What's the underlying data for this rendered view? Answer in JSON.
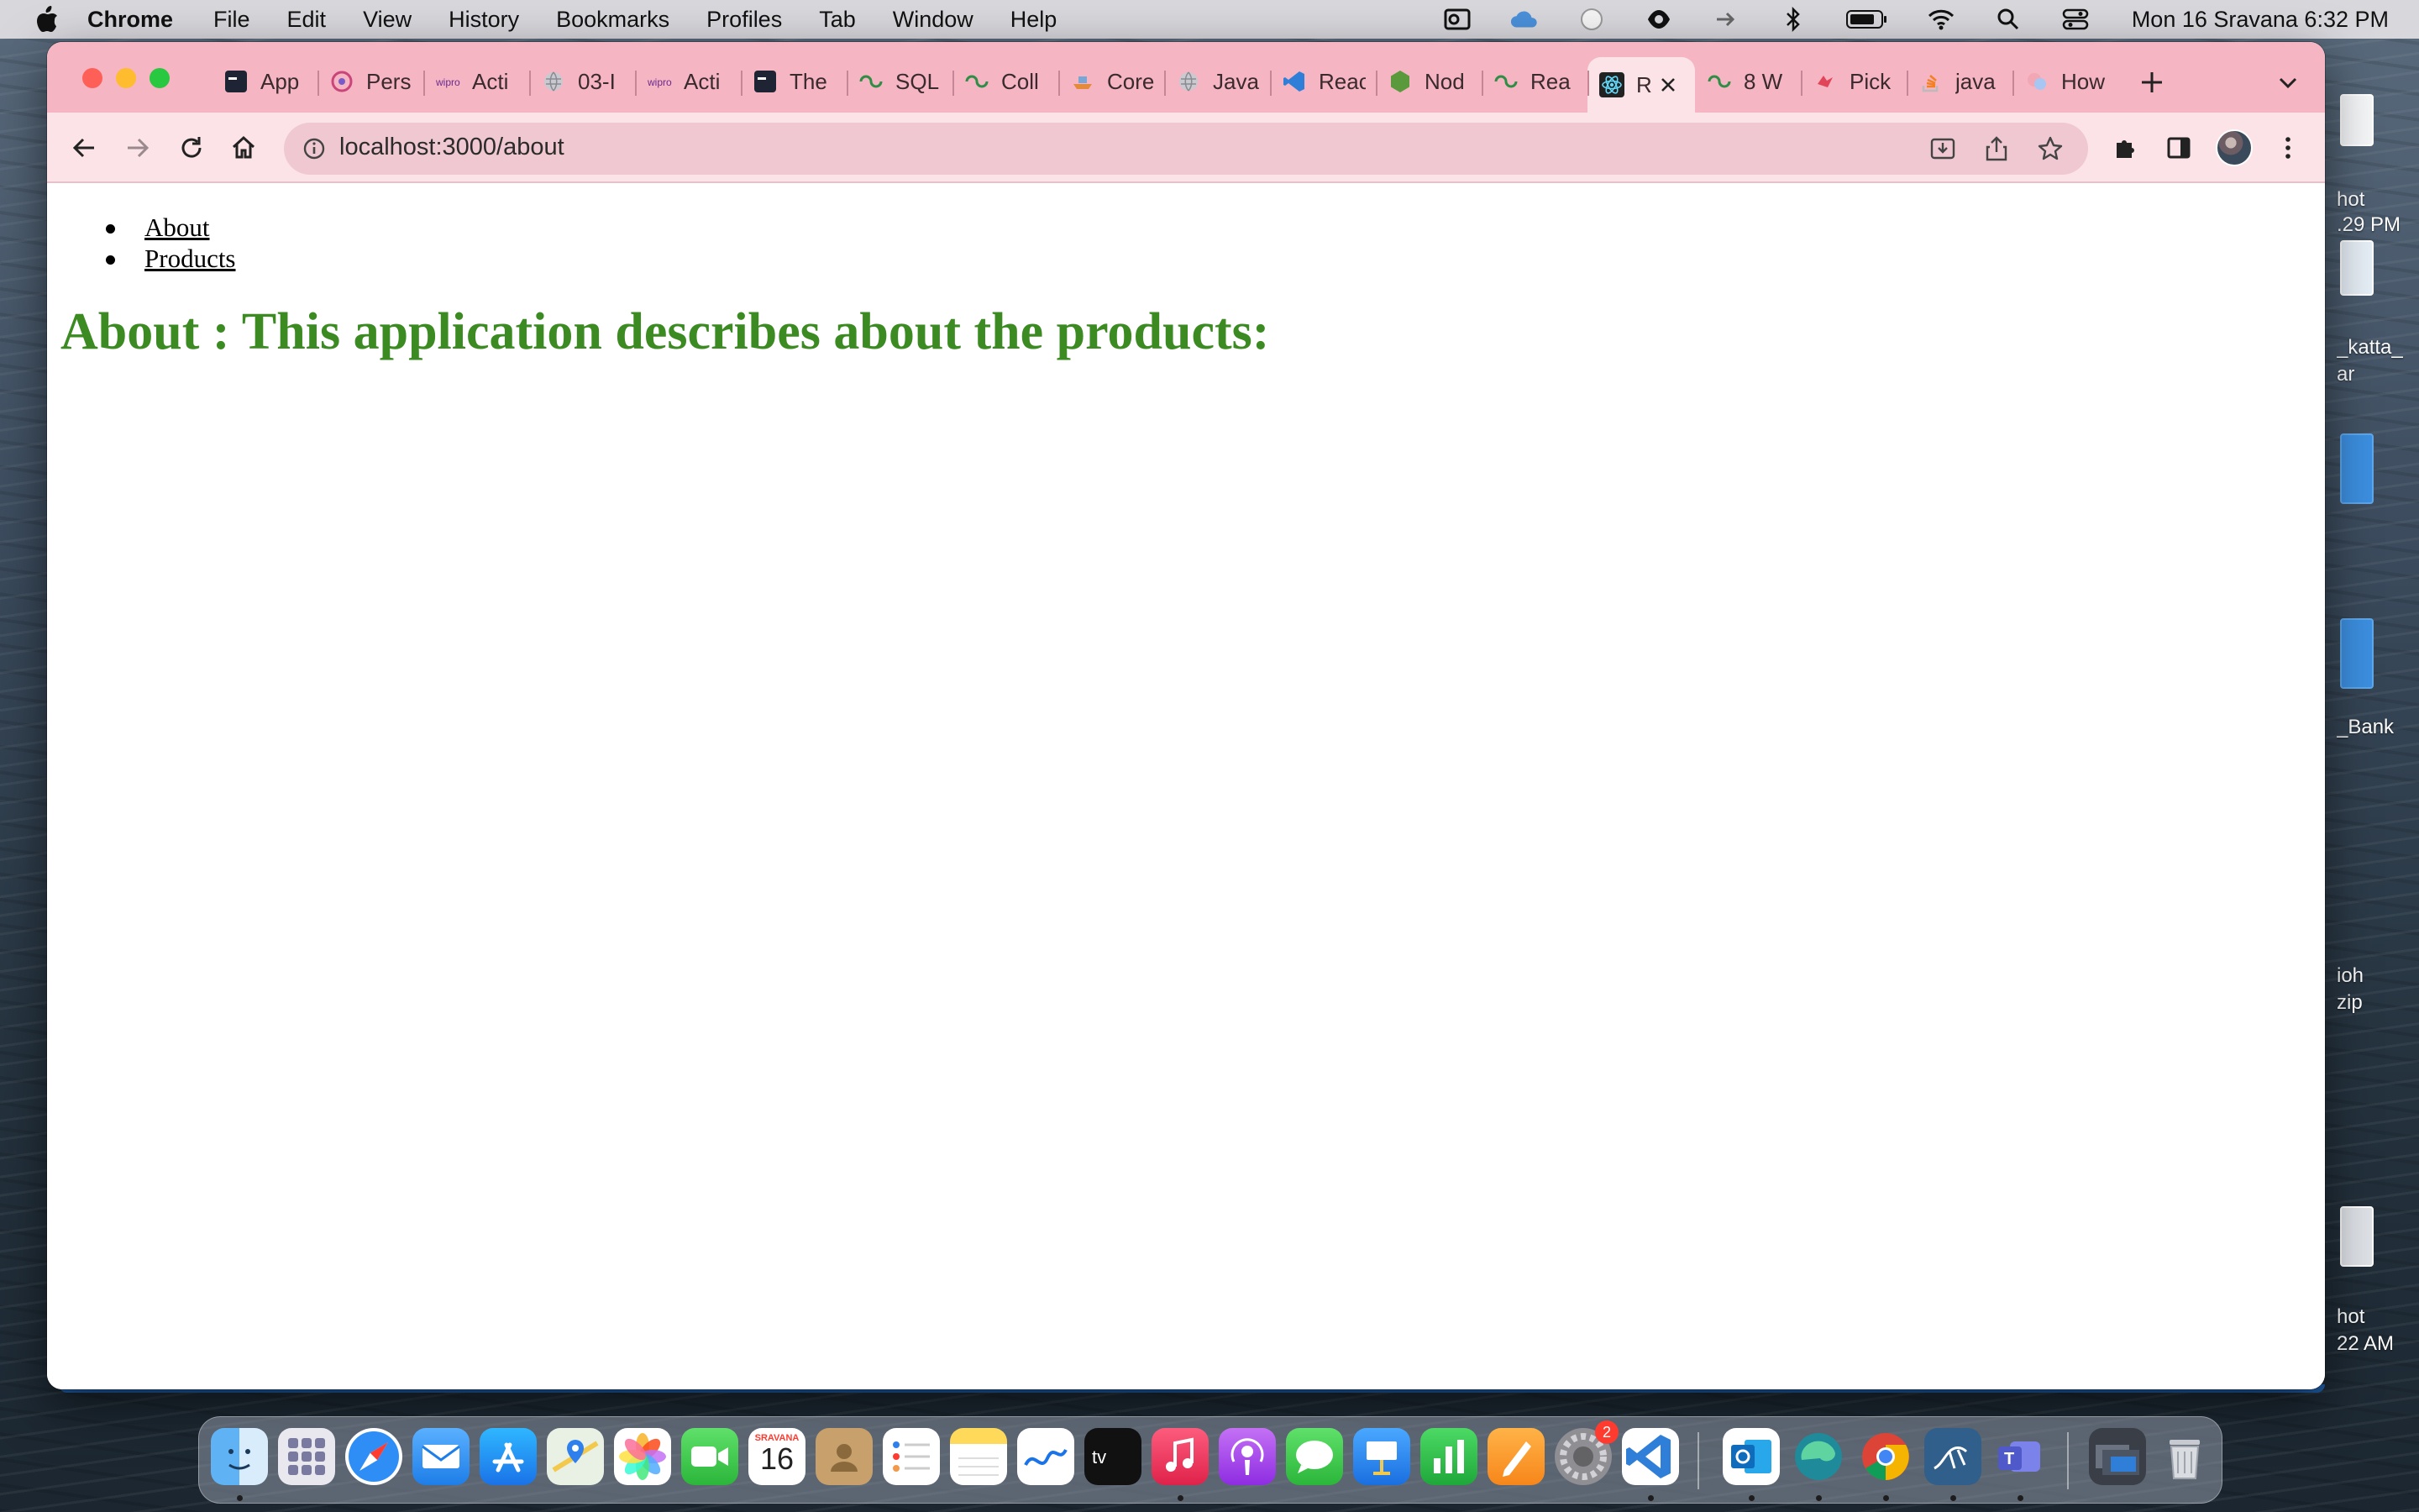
{
  "menubar": {
    "app_name": "Chrome",
    "menus": [
      "File",
      "Edit",
      "View",
      "History",
      "Bookmarks",
      "Profiles",
      "Tab",
      "Window",
      "Help"
    ],
    "clock": "Mon 16 Sravana  6:32 PM",
    "status_icons": [
      "outlook-icon",
      "cloud-icon",
      "circle-icon",
      "eye-icon",
      "arrow-icon",
      "bluetooth-icon",
      "battery-icon",
      "wifi-icon",
      "search-icon",
      "control-center-icon"
    ]
  },
  "tabs": [
    {
      "label": "App",
      "icon": "app-icon"
    },
    {
      "label": "Pers",
      "icon": "wipro-icon"
    },
    {
      "label": "Acti",
      "icon": "wipro-icon"
    },
    {
      "label": "03-I",
      "icon": "globe-icon"
    },
    {
      "label": "Acti",
      "icon": "wipro-icon"
    },
    {
      "label": "The",
      "icon": "app-icon"
    },
    {
      "label": "SQL",
      "icon": "geeksforgeeks-icon"
    },
    {
      "label": "Coll",
      "icon": "geeksforgeeks-icon"
    },
    {
      "label": "Core",
      "icon": "ship-icon"
    },
    {
      "label": "Java",
      "icon": "globe-icon"
    },
    {
      "label": "Reac",
      "icon": "vscode-icon"
    },
    {
      "label": "Nod",
      "icon": "nodejs-icon"
    },
    {
      "label": "Rea",
      "icon": "geeksforgeeks-icon"
    },
    {
      "label": "R",
      "icon": "react-icon",
      "active": true
    },
    {
      "label": "8 W",
      "icon": "geeksforgeeks-icon"
    },
    {
      "label": "Pick",
      "icon": "pick-icon"
    },
    {
      "label": "java",
      "icon": "stackoverflow-icon"
    },
    {
      "label": "How",
      "icon": "how-icon"
    }
  ],
  "omnibox": {
    "url": "localhost:3000/about"
  },
  "page": {
    "nav": [
      "About",
      "Products"
    ],
    "heading": "About : This application describes about the products:"
  },
  "colors": {
    "tabstrip": "#f5b5c2",
    "toolbar": "#fbe3e8",
    "heading": "#3b8a22"
  },
  "desktop": {
    "files": [
      "hot",
      ".29 PM",
      "_katta_",
      "ar",
      "_Bank",
      "ioh",
      "zip",
      "hot",
      "22 AM"
    ]
  },
  "dock": {
    "apps": [
      "finder-icon",
      "launchpad-icon",
      "safari-icon",
      "mail-icon",
      "app-store-icon",
      "maps-icon",
      "photos-icon",
      "facetime-icon",
      "calendar-icon",
      "contacts-icon",
      "reminders-icon",
      "notes-icon",
      "freeform-icon",
      "apple-tv-icon",
      "music-icon",
      "podcasts-icon",
      "messages-icon",
      "keynote-icon",
      "numbers-icon",
      "pages-icon",
      "system-settings-icon",
      "vscode-icon",
      "outlook-icon",
      "edge-icon",
      "chrome-icon",
      "mysql-workbench-icon",
      "teams-icon",
      "downloads-stack-icon",
      "trash-icon"
    ],
    "calendar": {
      "month": "SRAVANA",
      "day": "16"
    },
    "settings_badge": "2"
  }
}
